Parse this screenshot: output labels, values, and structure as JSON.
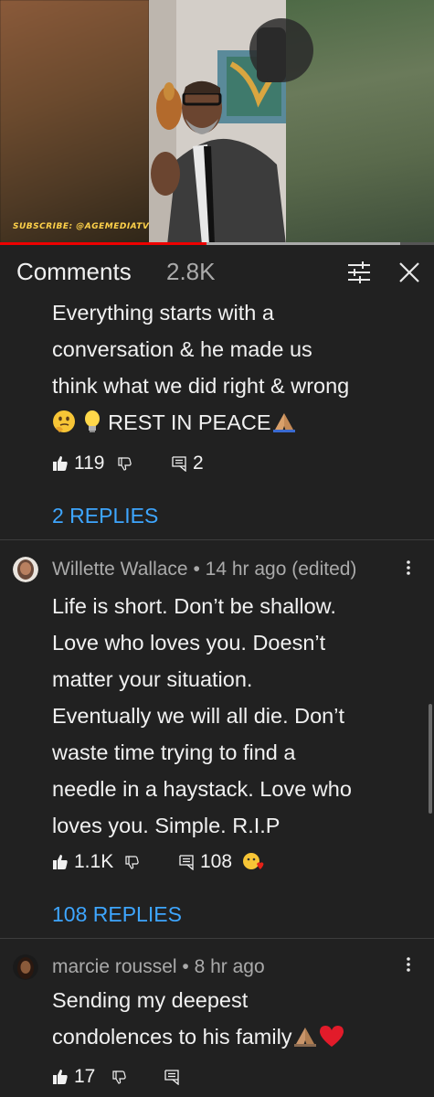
{
  "video": {
    "watermark": "SUBSCRIBE: @AGEMEDIATV",
    "progress_fraction": 0.476
  },
  "header": {
    "title": "Comments",
    "count": "2.8K"
  },
  "comments": [
    {
      "lines": [
        "Everything starts with a",
        "conversation & he made us",
        "think what we did right & wrong"
      ],
      "last_line_text": "REST IN PEACE",
      "likes": "119",
      "replies_count": "2",
      "replies_label": "2 REPLIES"
    },
    {
      "author": "Willette Wallace",
      "time": "14 hr ago (edited)",
      "lines": [
        "Life is short. Don’t be shallow.",
        "Love who loves you. Doesn’t",
        "matter your situation.",
        "Eventually we will all die. Don’t",
        "waste time trying to find a",
        "needle in a haystack. Love who",
        "loves you. Simple. R.I.P"
      ],
      "likes": "1.1K",
      "replies_count": "108",
      "replies_label": "108 REPLIES"
    },
    {
      "author": "marcie roussel",
      "time": "8 hr ago",
      "lines": [
        "Sending my deepest",
        "condolences to his family"
      ],
      "likes": "17"
    }
  ],
  "icons": {
    "like": "thumbs-up-icon",
    "dislike": "thumbs-down-icon",
    "reply": "reply-icon",
    "filter": "sliders-icon",
    "close": "close-icon",
    "more": "more-vert-icon"
  },
  "colors": {
    "background": "#212121",
    "link": "#3ea6ff",
    "text": "#f1f1f1",
    "secondary": "#aaaaaa",
    "progress": "#ee0000"
  }
}
